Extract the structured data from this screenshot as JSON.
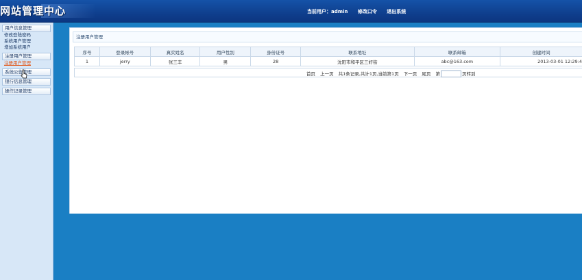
{
  "header": {
    "logo": "网站管理中心",
    "current_user_label": "当前用户：admin",
    "change_password": "修改口令",
    "logout": "退出系统"
  },
  "sidebar": {
    "groups": [
      {
        "label": "用户信息管理",
        "items": [
          "修改登陆密码",
          "系统用户管理",
          "增加系统用户"
        ]
      },
      {
        "label": "注册用户管理",
        "items": [
          "注册用户管理"
        ]
      },
      {
        "label": "系统公告管理",
        "items": []
      },
      {
        "label": "银行信息管理",
        "items": []
      },
      {
        "label": "操作记录管理",
        "items": []
      }
    ]
  },
  "panel": {
    "title": "注册用户管理",
    "table": {
      "headers": [
        "序号",
        "登录帐号",
        "真实姓名",
        "用户性别",
        "身份证号",
        "联系地址",
        "联系邮箱",
        "创建时间"
      ],
      "rows": [
        [
          "1",
          "jerry",
          "张三丰",
          "男",
          "28",
          "沈阳市和平区三好街",
          "abc@163.com",
          "2013-03-01 12:29:4"
        ]
      ]
    },
    "pager": {
      "first": "首页",
      "prev": "上一页",
      "summary": "共1条记录,共计1页,当前第1页",
      "next": "下一页",
      "last": "尾页",
      "goto_prefix": "第",
      "goto_suffix": "页",
      "goto_button": "转到",
      "input_value": ""
    }
  }
}
